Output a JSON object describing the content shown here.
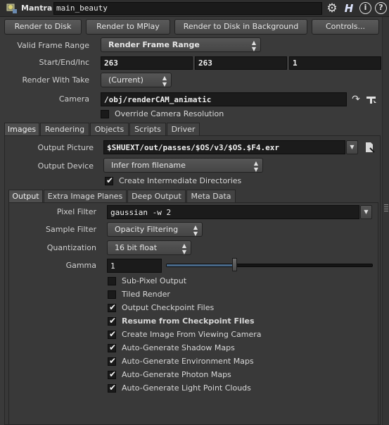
{
  "title_bar": {
    "node_type": "Mantra",
    "node_name": "main_beauty",
    "icons": [
      "mantra-node-icon",
      "gear-icon",
      "houdini-help-icon",
      "info-icon",
      "help-icon"
    ]
  },
  "actions": {
    "render_to_disk": "Render to Disk",
    "render_to_mplay": "Render to MPlay",
    "render_background": "Render to Disk in Background",
    "controls": "Controls..."
  },
  "params": {
    "valid_frame_range": {
      "label": "Valid Frame Range",
      "value": "Render Frame Range"
    },
    "start_end_inc": {
      "label": "Start/End/Inc",
      "start": "263",
      "end": "263",
      "inc": "1"
    },
    "render_with_take": {
      "label": "Render With Take",
      "value": "(Current)"
    },
    "camera": {
      "label": "Camera",
      "value": "/obj/renderCAM_animatic"
    },
    "override_camera_resolution": {
      "label": "Override Camera Resolution",
      "checked": false
    }
  },
  "main_tabs": [
    "Images",
    "Rendering",
    "Objects",
    "Scripts",
    "Driver"
  ],
  "images": {
    "output_picture": {
      "label": "Output Picture",
      "value": "$SHUEXT/out/passes/$OS/v3/$OS.$F4.exr"
    },
    "output_device": {
      "label": "Output Device",
      "value": "Infer from filename"
    },
    "create_intermediate_dirs": {
      "label": "Create Intermediate Directories",
      "checked": true
    }
  },
  "sub_tabs": [
    "Output",
    "Extra Image Planes",
    "Deep Output",
    "Meta Data"
  ],
  "output": {
    "pixel_filter": {
      "label": "Pixel Filter",
      "value": "gaussian -w 2"
    },
    "sample_filter": {
      "label": "Sample Filter",
      "value": "Opacity Filtering"
    },
    "quantization": {
      "label": "Quantization",
      "value": "16 bit float"
    },
    "gamma": {
      "label": "Gamma",
      "value": "1",
      "slider_fraction": 0.33
    },
    "checkboxes": [
      {
        "label": "Sub-Pixel Output",
        "checked": false,
        "bold": false
      },
      {
        "label": "Tiled Render",
        "checked": false,
        "bold": false
      },
      {
        "label": "Output Checkpoint Files",
        "checked": true,
        "bold": false
      },
      {
        "label": "Resume from Checkpoint Files",
        "checked": true,
        "bold": true
      },
      {
        "label": "Create Image From Viewing Camera",
        "checked": true,
        "bold": false
      },
      {
        "label": "Auto-Generate Shadow Maps",
        "checked": true,
        "bold": false
      },
      {
        "label": "Auto-Generate Environment Maps",
        "checked": true,
        "bold": false
      },
      {
        "label": "Auto-Generate Photon Maps",
        "checked": true,
        "bold": false
      },
      {
        "label": "Auto-Generate Light Point Clouds",
        "checked": true,
        "bold": false
      }
    ]
  }
}
